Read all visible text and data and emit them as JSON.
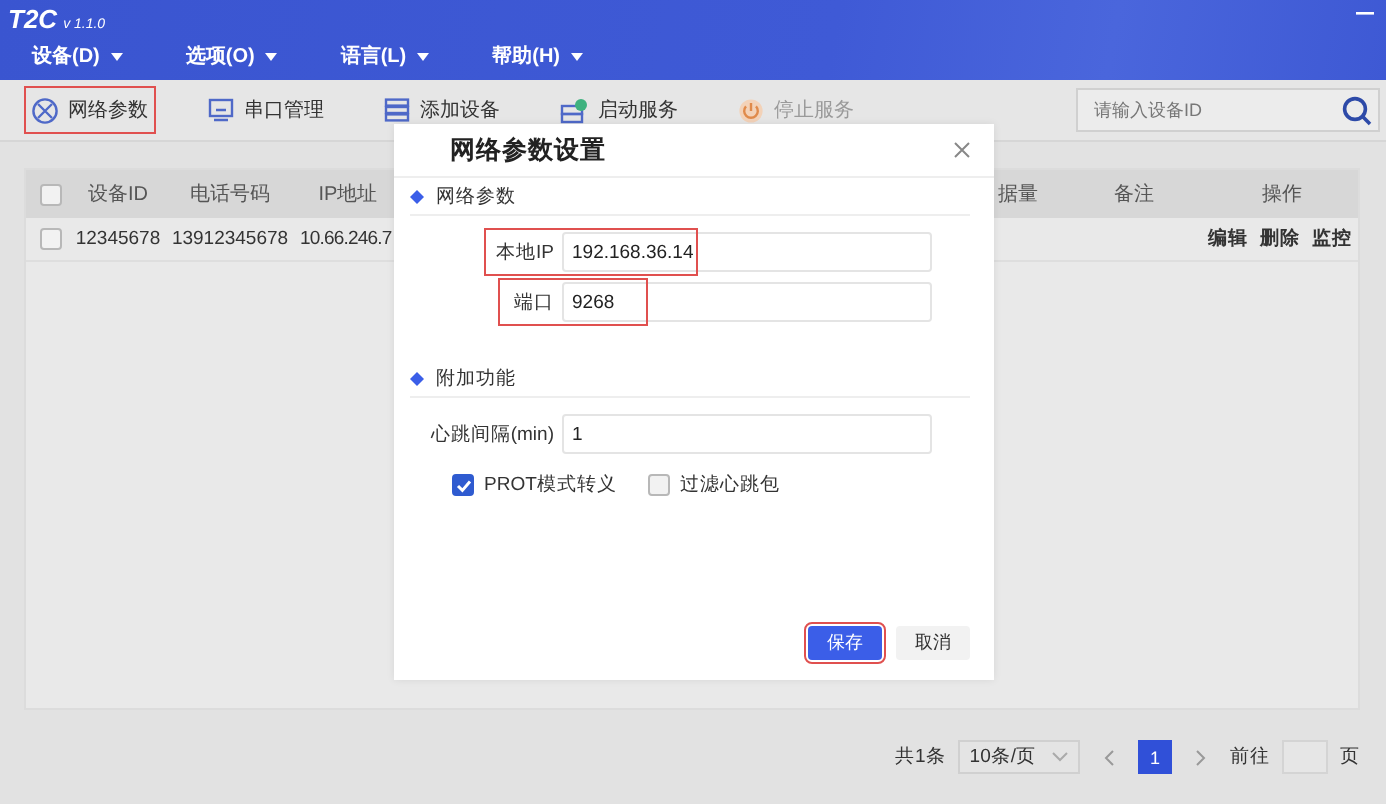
{
  "window": {
    "title": "T2C",
    "version": "v 1.1.0"
  },
  "menus": [
    {
      "label": "设备(D)"
    },
    {
      "label": "选项(O)"
    },
    {
      "label": "语言(L)"
    },
    {
      "label": "帮助(H)"
    }
  ],
  "toolbar": [
    {
      "label": "网络参数",
      "highlighted": true,
      "disabled": false
    },
    {
      "label": "串口管理",
      "highlighted": false,
      "disabled": false
    },
    {
      "label": "添加设备",
      "highlighted": false,
      "disabled": false
    },
    {
      "label": "启动服务",
      "highlighted": false,
      "disabled": false
    },
    {
      "label": "停止服务",
      "highlighted": false,
      "disabled": true
    }
  ],
  "search": {
    "placeholder": "请输入设备ID"
  },
  "table": {
    "all_checked": false,
    "columns": [
      {
        "label": "设备ID"
      },
      {
        "label": "电话号码"
      },
      {
        "label": "IP地址"
      },
      {
        "label": "据量"
      },
      {
        "label": "备注"
      },
      {
        "label": "操作"
      }
    ],
    "rows": [
      {
        "checked": false,
        "cells": [
          "12345678",
          "13912345678",
          "10.66.246.7"
        ],
        "actions": [
          "编辑",
          "删除",
          "监控"
        ]
      }
    ]
  },
  "pager": {
    "total": "共1条",
    "page_size": "10条/页",
    "pages": [
      {
        "label": "1",
        "selected": true
      }
    ],
    "goto": "前往",
    "unit": "页"
  },
  "dialog": {
    "title": "网络参数设置",
    "sections": [
      {
        "title": "网络参数",
        "fields": [
          {
            "label": "本地IP",
            "value": "192.168.36.14",
            "highlighted": true
          },
          {
            "label": "端口",
            "value": "9268",
            "highlighted": true
          }
        ]
      },
      {
        "title": "附加功能",
        "fields": [
          {
            "label": "心跳间隔(min)",
            "value": "1",
            "highlighted": false
          }
        ],
        "checkboxes": [
          {
            "label": "PROT模式转义",
            "checked": true
          },
          {
            "label": "过滤心跳包",
            "checked": false
          }
        ]
      }
    ],
    "buttons": [
      {
        "label": "保存",
        "kind": "primary",
        "highlighted": true
      },
      {
        "label": "取消",
        "kind": "secondary",
        "highlighted": false
      }
    ]
  }
}
